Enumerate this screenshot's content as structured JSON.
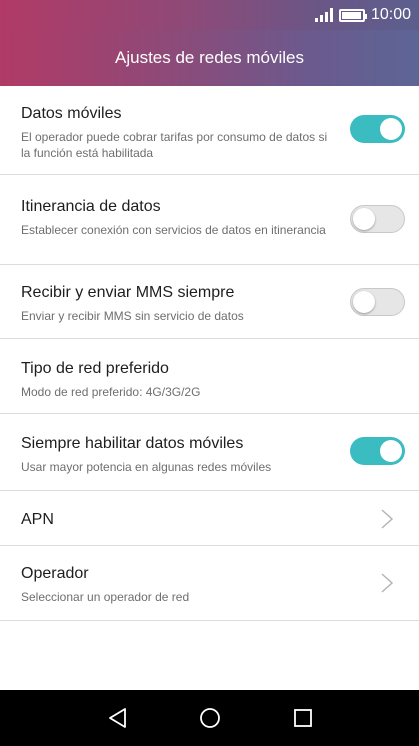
{
  "status_bar": {
    "time": "10:00",
    "icons": [
      "signal-icon",
      "battery-icon"
    ]
  },
  "app_bar": {
    "title": "Ajustes de redes móviles",
    "gradient_colors": [
      "#b13a66",
      "#5d6596"
    ]
  },
  "settings": [
    {
      "title": "Datos móviles",
      "subtitle": "El operador puede cobrar tarifas por consumo de datos si la función está habilitada",
      "control": "toggle",
      "enabled": true
    },
    {
      "title": "Itinerancia de datos",
      "subtitle": "Establecer conexión con servicios de datos en itinerancia",
      "control": "toggle",
      "enabled": false
    },
    {
      "title": "Recibir y enviar MMS siempre",
      "subtitle": "Enviar y recibir MMS sin servicio de datos",
      "control": "toggle",
      "enabled": false
    },
    {
      "title": "Tipo de red preferido",
      "subtitle": "Modo de red preferido: 4G/3G/2G",
      "control": "none"
    },
    {
      "title": "Siempre habilitar datos móviles",
      "subtitle": "Usar mayor potencia en algunas redes móviles",
      "control": "toggle",
      "enabled": true
    },
    {
      "title": "APN",
      "subtitle": "",
      "control": "chevron"
    },
    {
      "title": "Operador",
      "subtitle": "Seleccionar un operador de red",
      "control": "chevron"
    }
  ],
  "colors": {
    "toggle_on": "#3bbcc0",
    "toggle_off": "#e6e6e6",
    "divider": "#dcdcdc"
  },
  "nav_bar": {
    "buttons": [
      "back-icon",
      "home-icon",
      "recents-icon"
    ]
  }
}
